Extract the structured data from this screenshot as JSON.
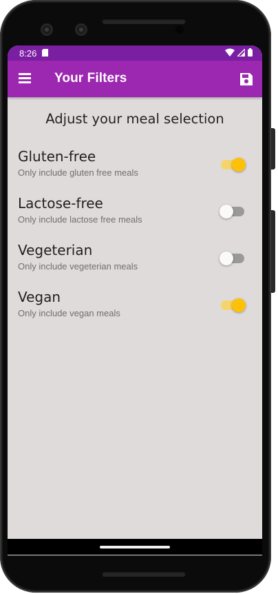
{
  "status_bar": {
    "time": "8:26",
    "icons": [
      "sd-card-icon",
      "wifi-icon",
      "cellular-icon",
      "battery-icon"
    ]
  },
  "app_bar": {
    "title": "Your Filters",
    "menu_icon": "hamburger-menu-icon",
    "save_icon": "save-icon",
    "color": "#9c27b0",
    "status_color": "#7b1fa2"
  },
  "main": {
    "heading": "Adjust your meal selection",
    "background": "#e0dbdb",
    "filters": [
      {
        "title": "Gluten-free",
        "subtitle": "Only include gluten free meals",
        "enabled": true
      },
      {
        "title": "Lactose-free",
        "subtitle": "Only include lactose free meals",
        "enabled": false
      },
      {
        "title": "Vegeterian",
        "subtitle": "Only include vegeterian meals",
        "enabled": false
      },
      {
        "title": "Vegan",
        "subtitle": "Only include vegan meals",
        "enabled": true
      }
    ]
  },
  "colors": {
    "switch_on_thumb": "#ffc107",
    "switch_on_track": "#f5d56b",
    "switch_off_thumb": "#fafafa",
    "switch_off_track": "#9b9898"
  }
}
